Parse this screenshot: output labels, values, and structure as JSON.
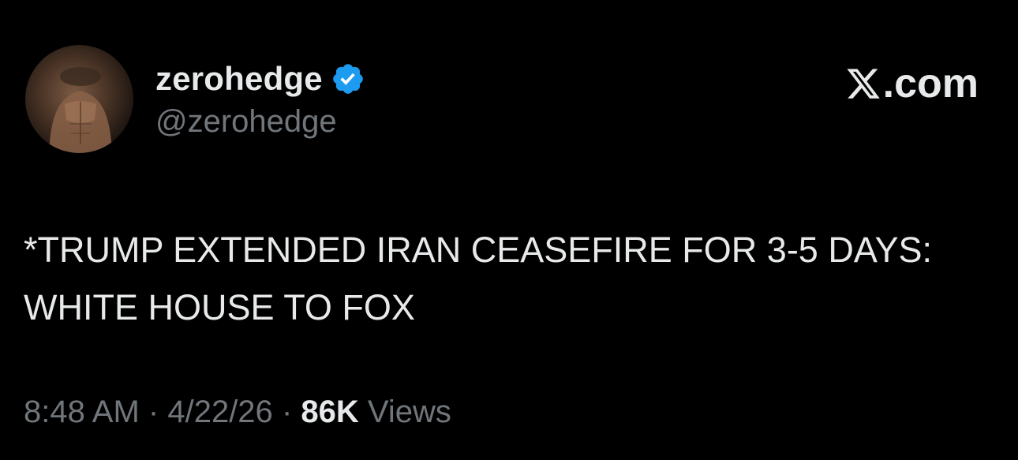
{
  "author": {
    "display_name": "zerohedge",
    "handle": "@zerohedge",
    "verified_badge_color": "#1d9bf0",
    "avatar_icon": "profile-photo"
  },
  "brand": {
    "icon": "x-logo-icon",
    "domain_suffix": ".com"
  },
  "tweet": {
    "text": "*TRUMP EXTENDED IRAN CEASEFIRE FOR 3-5 DAYS: WHITE HOUSE TO FOX"
  },
  "meta": {
    "time": "8:48 AM",
    "separator": "·",
    "date": "4/22/26",
    "views_count": "86K",
    "views_label": "Views"
  },
  "colors": {
    "background": "#000000",
    "primary_text": "#e7e9ea",
    "secondary_text": "#71767b"
  }
}
